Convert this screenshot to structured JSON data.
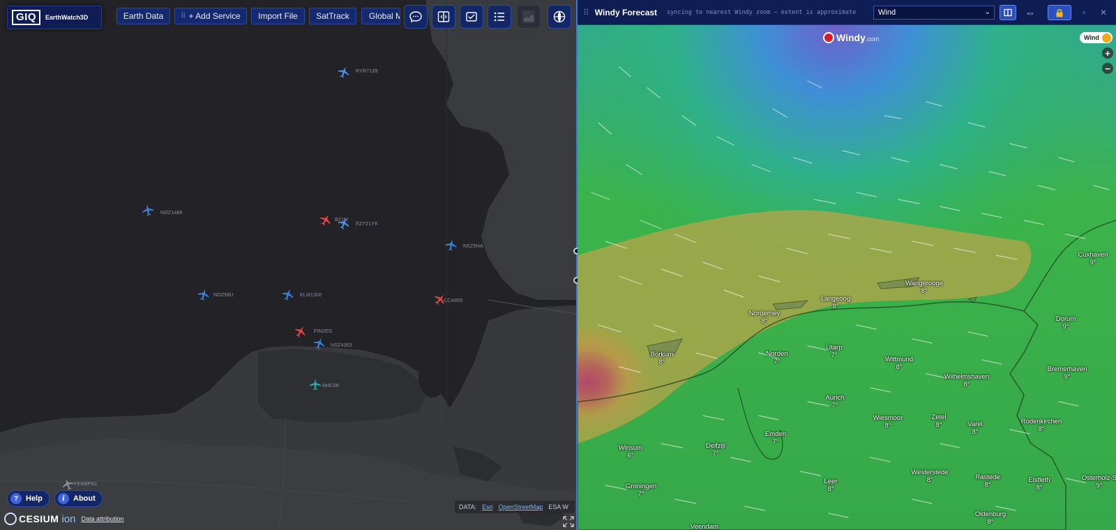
{
  "app": {
    "logo_text": "GIQ",
    "product_name": "EarthWatch3D"
  },
  "toolbar": {
    "earth_data": "Earth Data",
    "add_service": "+ Add Service",
    "import_file": "Import File",
    "sattrack": "SatTrack",
    "global": "Global M",
    "icons": [
      "chat-icon",
      "split-view-icon",
      "checklist-icon",
      "list-icon",
      "basemap-thumbnail",
      "globe-icon"
    ]
  },
  "aircraft": [
    {
      "label": "RYR7139",
      "color": "#4a90e2"
    },
    {
      "label": "NOZ1486",
      "color": "#3a80d9"
    },
    {
      "label": "B21M",
      "color": "#e04848"
    },
    {
      "label": "EZY21YK",
      "color": "#4a90e2"
    },
    {
      "label": "NSZ5HA",
      "color": "#3a80d9"
    },
    {
      "label": "NOZ58U",
      "color": "#3a80d9"
    },
    {
      "label": "KLM1300",
      "color": "#3a80d9"
    },
    {
      "label": "CCA855",
      "color": "#e04848"
    },
    {
      "label": "FIN2EG",
      "color": "#e04848"
    },
    {
      "label": "NSZ4353",
      "color": "#3a80d9"
    },
    {
      "label": "NHC06",
      "color": "#2fa7a7"
    },
    {
      "label": "FEM8PN1",
      "color": "#8a8f99"
    }
  ],
  "bottom_left": {
    "help": "Help",
    "about": "About",
    "cesium": "CESIUM",
    "ion": "ion",
    "data_attribution": "Data attribution"
  },
  "attribution": {
    "data_label": "DATA:",
    "esri": "Esri",
    "osm": "OpenStreetMap",
    "esa": "ESA W"
  },
  "windy": {
    "title": "Windy Forecast",
    "subtitle": "syncing to nearest Windy zoom — extent is approximate",
    "layer": "Wind",
    "logo": "Windy",
    "logo_suffix": ".com",
    "badge": "Wind",
    "zoom_in": "+",
    "zoom_out": "−",
    "cities": [
      {
        "name": "Cuxhaven",
        "temp": "9°"
      },
      {
        "name": "Wangerooge",
        "temp": "8°"
      },
      {
        "name": "Langeoog",
        "temp": "8°"
      },
      {
        "name": "Norderney",
        "temp": "8°"
      },
      {
        "name": "Dorum",
        "temp": "9°"
      },
      {
        "name": "Borkum",
        "temp": "8°"
      },
      {
        "name": "Norden",
        "temp": "7°"
      },
      {
        "name": "Utarp",
        "temp": "7°"
      },
      {
        "name": "Wittmund",
        "temp": "8°"
      },
      {
        "name": "Wilhelmshaven",
        "temp": "8°"
      },
      {
        "name": "Bremerhaven",
        "temp": "9°"
      },
      {
        "name": "Aurich",
        "temp": "7°"
      },
      {
        "name": "Wiesmoor",
        "temp": "8°"
      },
      {
        "name": "Zetel",
        "temp": "8°"
      },
      {
        "name": "Varel",
        "temp": "8°"
      },
      {
        "name": "Rodenkirchen",
        "temp": "8°"
      },
      {
        "name": "Emden",
        "temp": "7°"
      },
      {
        "name": "Winsum",
        "temp": "6°"
      },
      {
        "name": "Delfzijl",
        "temp": "7°"
      },
      {
        "name": "Groningen",
        "temp": "7°"
      },
      {
        "name": "Leer",
        "temp": "8°"
      },
      {
        "name": "Westerstede",
        "temp": "8°"
      },
      {
        "name": "Rastede",
        "temp": "8°"
      },
      {
        "name": "Elsfleth",
        "temp": "8°"
      },
      {
        "name": "Osterholz-S",
        "temp": "9°"
      },
      {
        "name": "Oldenburg",
        "temp": "8°"
      },
      {
        "name": "Veendam",
        "temp": ""
      }
    ]
  }
}
